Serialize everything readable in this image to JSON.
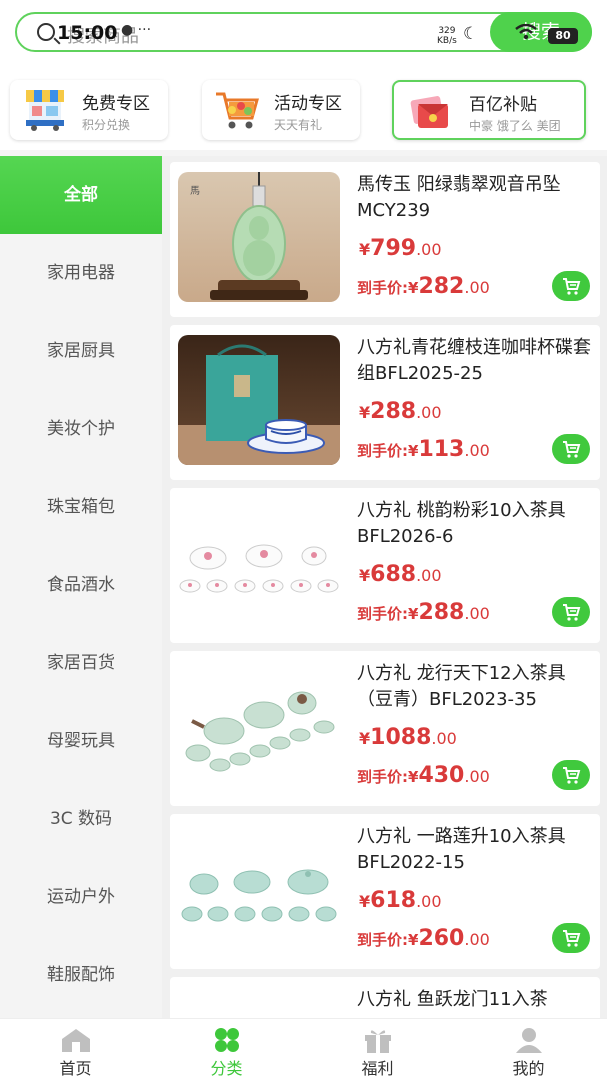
{
  "status_bar": {
    "time": "15:00",
    "network_speed": "329",
    "network_unit": "KB/s",
    "battery": "80"
  },
  "search": {
    "placeholder": "搜索商品",
    "button": "搜索"
  },
  "promos": [
    {
      "title": "免费专区",
      "subtitle": "积分兑换"
    },
    {
      "title": "活动专区",
      "subtitle": "天天有礼"
    },
    {
      "title": "百亿补贴",
      "subtitle": "中豪 饿了么 美团"
    }
  ],
  "categories": [
    "全部",
    "家用电器",
    "家居厨具",
    "美妆个护",
    "珠宝箱包",
    "食品酒水",
    "家居百货",
    "母婴玩具",
    "3C 数码",
    "运动户外",
    "鞋服配饰"
  ],
  "active_category": "全部",
  "final_price_label": "到手价:",
  "currency": "¥",
  "products": [
    {
      "name": "馬传玉 阳绿翡翠观音吊坠MCY239",
      "price_int": "799",
      "price_dec": ".00",
      "final_int": "282",
      "final_dec": ".00"
    },
    {
      "name": "八方礼青花缠枝连咖啡杯碟套组BFL2025-25",
      "price_int": "288",
      "price_dec": ".00",
      "final_int": "113",
      "final_dec": ".00"
    },
    {
      "name": "八方礼 桃韵粉彩10入茶具BFL2026-6",
      "price_int": "688",
      "price_dec": ".00",
      "final_int": "288",
      "final_dec": ".00"
    },
    {
      "name": "八方礼 龙行天下12入茶具（豆青）BFL2023-35",
      "price_int": "1088",
      "price_dec": ".00",
      "final_int": "430",
      "final_dec": ".00"
    },
    {
      "name": "八方礼 一路莲升10入茶具BFL2022-15",
      "price_int": "618",
      "price_dec": ".00",
      "final_int": "260",
      "final_dec": ".00"
    },
    {
      "name": "八方礼 鱼跃龙门11入茶"
    }
  ],
  "nav": [
    {
      "label": "首页",
      "icon": "home-icon"
    },
    {
      "label": "分类",
      "icon": "category-icon"
    },
    {
      "label": "福利",
      "icon": "gift-icon"
    },
    {
      "label": "我的",
      "icon": "user-icon"
    }
  ],
  "colors": {
    "accent": "#4fd24c",
    "price": "#d93a3a"
  }
}
